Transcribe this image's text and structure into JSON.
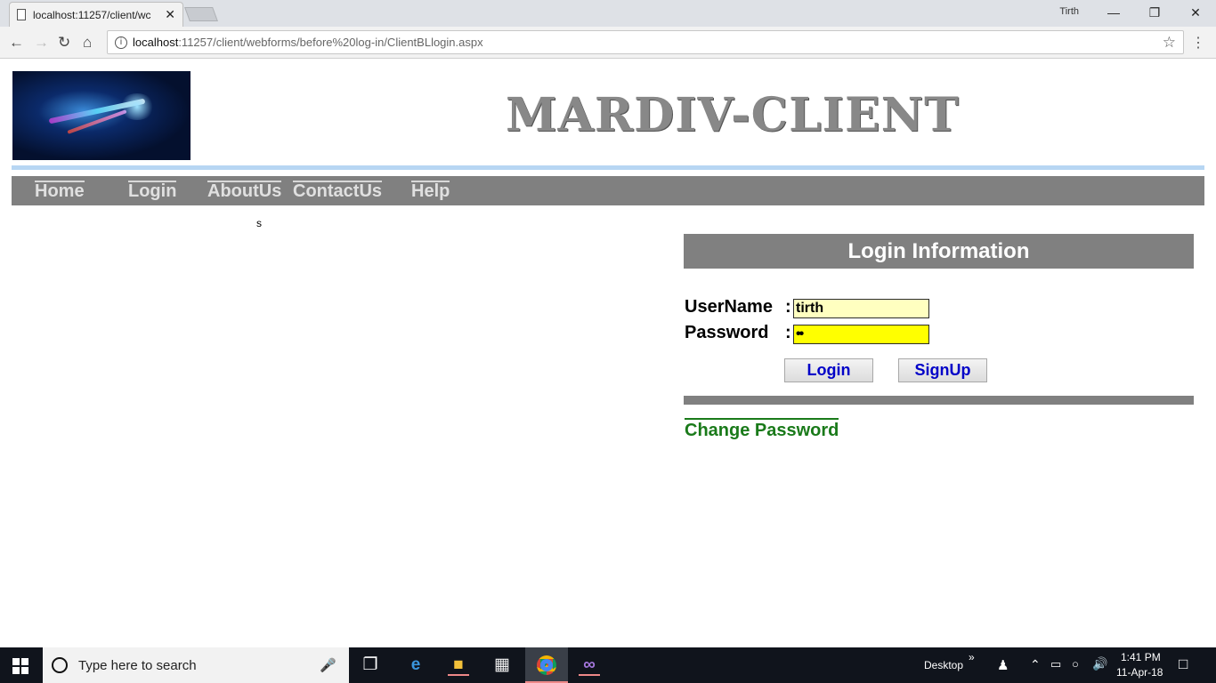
{
  "browser": {
    "tab_title": "localhost:11257/client/wc",
    "tab_close": "✕",
    "window_user": "Tirth",
    "url_host": "localhost",
    "url_path": ":11257/client/webforms/before%20log-in/ClientBLlogin.aspx",
    "icons": [
      "back-icon",
      "forward-icon",
      "reload-icon",
      "home-icon",
      "info-icon",
      "star-icon",
      "menu-icon"
    ]
  },
  "site": {
    "title": "MARDIV-CLIENT",
    "logo_alt": "logo"
  },
  "nav": {
    "items": [
      {
        "label": "Home"
      },
      {
        "label": "Login"
      },
      {
        "label": "AboutUs"
      },
      {
        "label": "ContactUs"
      },
      {
        "label": "Help"
      }
    ]
  },
  "stray_text": "s",
  "login": {
    "heading": "Login Information",
    "username_label": "UserName",
    "password_label": "Password",
    "colon": ":",
    "username_value": "tirth",
    "password_value": "••",
    "login_button": "Login",
    "signup_button": "SignUp",
    "change_password": "Change Password"
  },
  "colors": {
    "username_bg": "#ffffc0",
    "password_bg": "#ffff00",
    "menubar": "#808080",
    "link_green": "#1a7a1a",
    "button_text": "#0000c8"
  },
  "taskbar": {
    "search_placeholder": "Type here to search",
    "desktop_label": "Desktop",
    "time": "1:41 PM",
    "date": "11-Apr-18",
    "chevron": "»"
  }
}
